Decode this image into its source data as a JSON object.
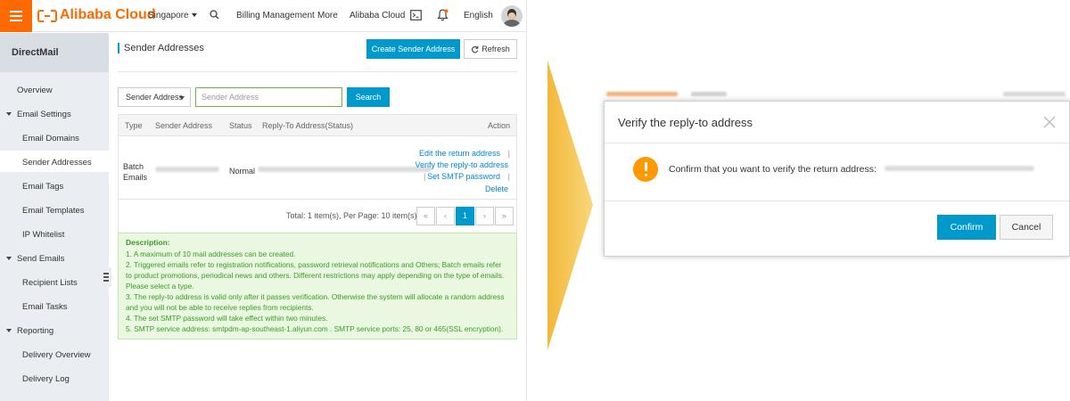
{
  "topbar": {
    "brand": "Alibaba Cloud",
    "region": "Singapore",
    "billing": "Billing Management",
    "more": "More",
    "alibaba_cloud": "Alibaba Cloud",
    "language": "English",
    "icons": [
      "menu-icon",
      "search-icon",
      "terminal-icon",
      "bell-icon",
      "user-avatar"
    ]
  },
  "sidebar": {
    "product": "DirectMail",
    "items": [
      {
        "label": "Overview",
        "level": 1,
        "active": false
      },
      {
        "label": "Email Settings",
        "level": 1,
        "group": true,
        "expanded": true
      },
      {
        "label": "Email Domains",
        "level": 2,
        "active": false
      },
      {
        "label": "Sender Addresses",
        "level": 2,
        "active": true
      },
      {
        "label": "Email Tags",
        "level": 2,
        "active": false
      },
      {
        "label": "Email Templates",
        "level": 2,
        "active": false
      },
      {
        "label": "IP Whitelist",
        "level": 2,
        "active": false
      },
      {
        "label": "Send Emails",
        "level": 1,
        "group": true,
        "expanded": true
      },
      {
        "label": "Recipient Lists",
        "level": 2,
        "active": false
      },
      {
        "label": "Email Tasks",
        "level": 2,
        "active": false
      },
      {
        "label": "Reporting",
        "level": 1,
        "group": true,
        "expanded": true
      },
      {
        "label": "Delivery Overview",
        "level": 2,
        "active": false
      },
      {
        "label": "Delivery Log",
        "level": 2,
        "active": false
      }
    ]
  },
  "main": {
    "title": "Sender Addresses",
    "create_label": "Create Sender Address",
    "refresh_label": "Refresh",
    "filter_value": "Sender Address",
    "search_placeholder": "Sender Address",
    "search_label": "Search",
    "table": {
      "headers": [
        "Type",
        "Sender Address",
        "Status",
        "Reply-To Address(Status)",
        "Action"
      ],
      "row": {
        "type_line1": "Batch",
        "type_line2": "Emails",
        "status": "Normal",
        "actions": [
          "Edit the return address",
          "Verify the reply-to address",
          "Set SMTP password",
          "Delete"
        ]
      }
    },
    "pagination": {
      "total_text": "Total: 1 item(s), Per Page: 10 item(s)",
      "first": "«",
      "prev": "‹",
      "current": "1",
      "next": "›",
      "last": "»"
    },
    "description": {
      "title": "Description:",
      "lines": [
        "1. A maximum of 10 mail addresses can be created.",
        "2. Triggered emails refer to registration notifications, password retrieval notifications and Others; Batch emails refer",
        "to product promotions, periodical news and others. Different restrictions may apply depending on the type of emails.",
        "Please select a type.",
        "3. The reply-to address is valid only after it passes verification. Otherwise the system will allocate a random address",
        "and you will not be able to receive replies from recipients.",
        "4. The set SMTP password will take effect within two minutes.",
        "5. SMTP service address: smtpdm-ap-southeast-1.aliyun.com . SMTP service ports: 25, 80 or 465(SSL encryption)."
      ]
    }
  },
  "dialog": {
    "title": "Verify the reply-to address",
    "message": "Confirm that you want to verify the return address:",
    "confirm_label": "Confirm",
    "cancel_label": "Cancel"
  },
  "colors": {
    "brand_orange": "#ff6a00",
    "primary_blue": "#0099cc",
    "link_blue": "#0088cc",
    "description_green": "#3a9d23",
    "description_bg": "#eaf7e1",
    "warning_orange": "#ff9900",
    "chevron_gold": "#f6c54b"
  }
}
